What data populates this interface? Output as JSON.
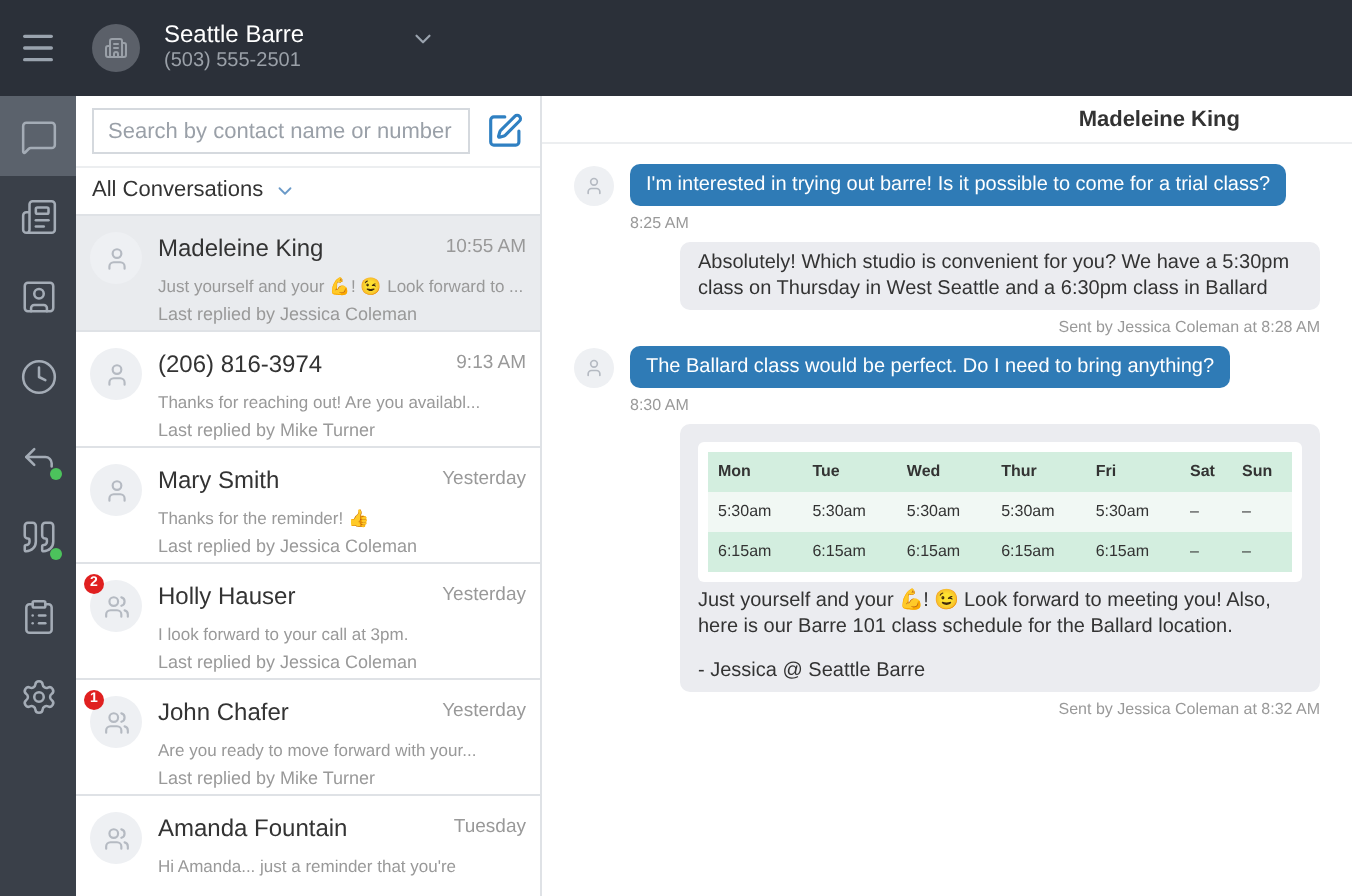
{
  "account": {
    "name": "Seattle Barre",
    "phone": "(503) 555-2501"
  },
  "rail": [
    {
      "kind": "messages",
      "selected": true,
      "alert": false
    },
    {
      "kind": "notes",
      "selected": false,
      "alert": false
    },
    {
      "kind": "contacts",
      "selected": false,
      "alert": false
    },
    {
      "kind": "history",
      "selected": false,
      "alert": false
    },
    {
      "kind": "replies",
      "selected": false,
      "alert": true
    },
    {
      "kind": "quotes",
      "selected": false,
      "alert": true
    },
    {
      "kind": "templates",
      "selected": false,
      "alert": false
    },
    {
      "kind": "settings",
      "selected": false,
      "alert": false
    }
  ],
  "search": {
    "placeholder": "Search by contact name or number"
  },
  "filter": "All Conversations",
  "conversations": [
    {
      "name": "Madeleine King",
      "time": "10:55 AM",
      "preview": "Just yourself and your 💪! 😉 Look forward to ...",
      "replied": "Last replied by Jessica Coleman",
      "kind": "person",
      "selected": true
    },
    {
      "name": "(206) 816-3974",
      "time": "9:13 AM",
      "preview": "Thanks for reaching out! Are you availabl...",
      "replied": "Last replied by Mike Turner",
      "kind": "person",
      "selected": false
    },
    {
      "name": "Mary Smith",
      "time": "Yesterday",
      "preview": "Thanks for the reminder! 👍",
      "replied": "Last replied by Jessica Coleman",
      "kind": "person",
      "selected": false
    },
    {
      "name": "Holly Hauser",
      "time": "Yesterday",
      "preview": "I look forward to your call at 3pm.",
      "replied": "Last replied by Jessica Coleman",
      "kind": "group",
      "unread": "2",
      "selected": false
    },
    {
      "name": "John Chafer",
      "time": "Yesterday",
      "preview": "Are you ready to move forward with your...",
      "replied": "Last replied by Mike Turner",
      "kind": "group",
      "unread": "1",
      "selected": false
    },
    {
      "name": "Amanda Fountain",
      "time": "Tuesday",
      "preview": "Hi Amanda... just a reminder that you're",
      "kind": "group",
      "selected": false
    }
  ],
  "chat": {
    "title": "Madeleine King",
    "messages": [
      {
        "kind": "incoming",
        "text": "I'm interested in trying out barre! Is it possible to come for a trial class?",
        "meta": "8:25 AM"
      },
      {
        "kind": "outgoing",
        "text": "Absolutely! Which studio is convenient for you? We have a 5:30pm class on Thursday in West Seattle and a 6:30pm class in Ballard",
        "meta": "Sent by Jessica Coleman at 8:28 AM"
      },
      {
        "kind": "incoming",
        "text": "The Ballard class would be perfect. Do I need to bring anything?",
        "meta": "8:30 AM"
      },
      {
        "kind": "outgoing",
        "table": {
          "columns": [
            "Mon",
            "Tue",
            "Wed",
            "Thur",
            "Fri",
            "Sat",
            "Sun"
          ],
          "rows": [
            [
              "5:30am",
              "5:30am",
              "5:30am",
              "5:30am",
              "5:30am",
              "–",
              "–"
            ],
            [
              "6:15am",
              "6:15am",
              "6:15am",
              "6:15am",
              "6:15am",
              "–",
              "–"
            ]
          ]
        },
        "text": "Just yourself and your 💪! 😉 Look forward to meeting you! Also, here is our Barre 101 class schedule for the Ballard location.",
        "signature": "- Jessica @ Seattle Barre",
        "meta": "Sent by Jessica Coleman at 8:32 AM"
      }
    ]
  }
}
